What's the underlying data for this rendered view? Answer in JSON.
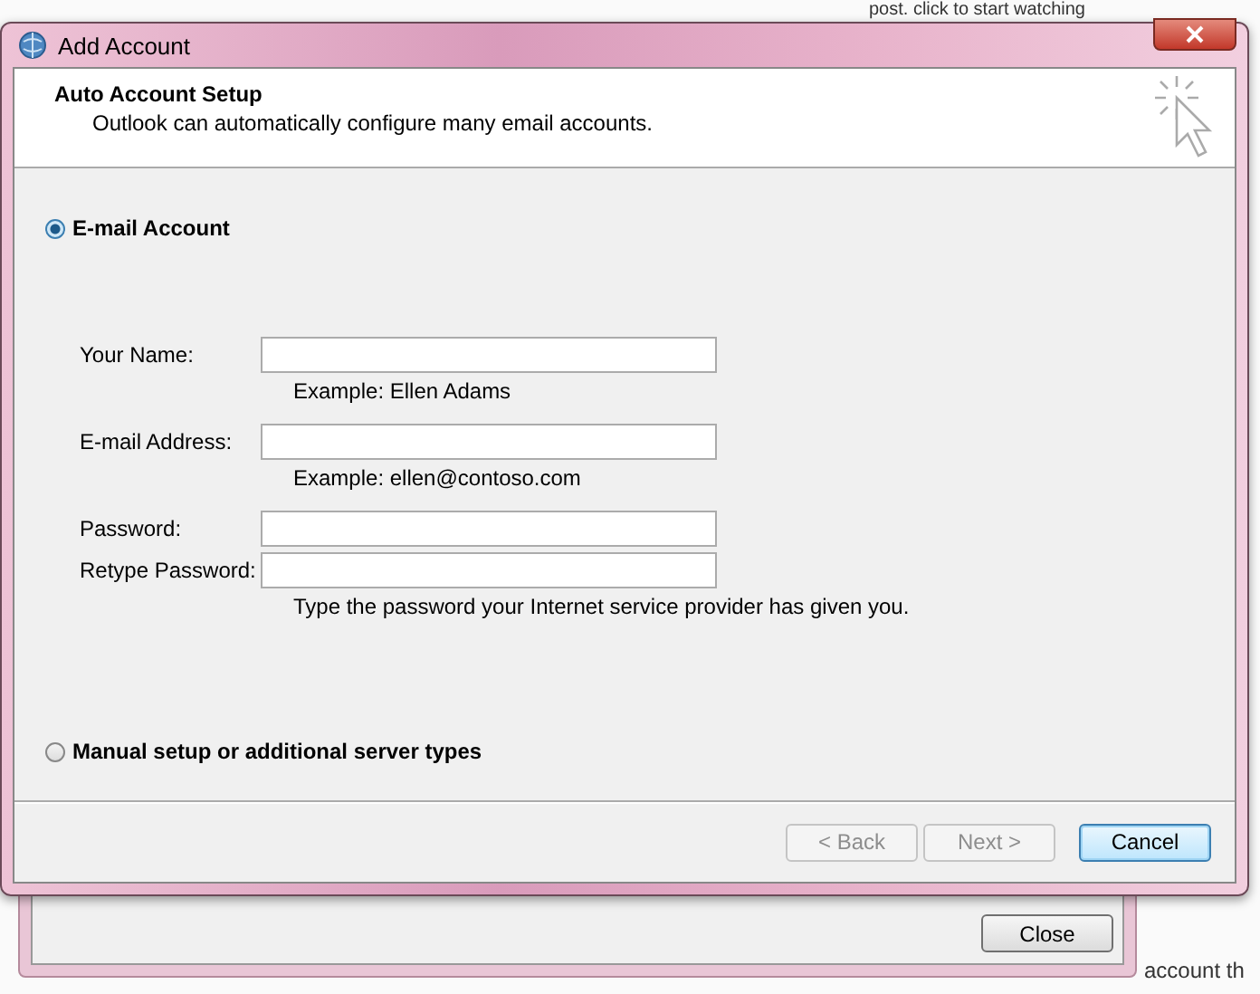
{
  "background": {
    "texts": [
      "post. click to start watching",
      "account th"
    ],
    "close_button": "Close"
  },
  "window": {
    "title": "Add Account"
  },
  "header": {
    "title": "Auto Account Setup",
    "subtitle": "Outlook can automatically configure many email accounts."
  },
  "options": [
    {
      "label": "E-mail Account",
      "selected": true
    },
    {
      "label": "Manual setup or additional server types",
      "selected": false
    }
  ],
  "fields": [
    {
      "label": "Your Name:",
      "hint": "Example: Ellen Adams"
    },
    {
      "label": "E-mail Address:",
      "hint": "Example: ellen@contoso.com"
    },
    {
      "label": "Password:"
    },
    {
      "label": "Retype Password:",
      "hint": "Type the password your Internet service provider has given you."
    }
  ],
  "buttons": [
    {
      "label": "< Back",
      "disabled": true,
      "default": false
    },
    {
      "label": "Next >",
      "disabled": true,
      "default": false
    },
    {
      "label": "Cancel",
      "disabled": false,
      "default": true
    }
  ]
}
